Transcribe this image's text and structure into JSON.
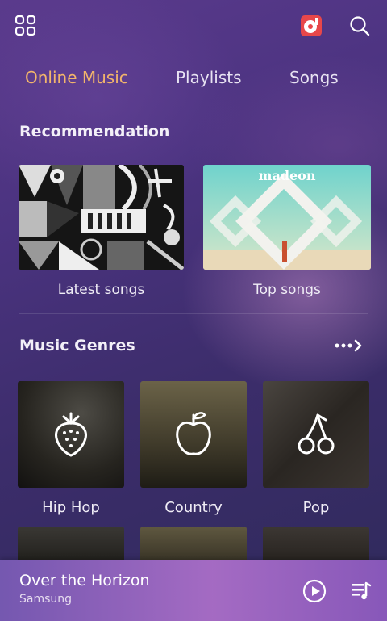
{
  "topbar": {
    "menu_icon": "grid-menu-icon",
    "music_app_icon": "music-disc-icon",
    "search_icon": "search-icon"
  },
  "tabs": [
    {
      "label": "Online Music",
      "active": true
    },
    {
      "label": "Playlists",
      "active": false
    },
    {
      "label": "Songs",
      "active": false
    }
  ],
  "recommendation": {
    "title": "Recommendation",
    "cards": [
      {
        "label": "Latest songs",
        "art": "abstract-mosaic-art"
      },
      {
        "label": "Top songs",
        "art": "madeon-album-art",
        "art_text": "madeon"
      }
    ]
  },
  "genres": {
    "title": "Music Genres",
    "more_icon": "more-arrow-icon",
    "items": [
      {
        "label": "Hip Hop",
        "icon": "strawberry-icon"
      },
      {
        "label": "Country",
        "icon": "apple-icon"
      },
      {
        "label": "Pop",
        "icon": "cherries-icon"
      }
    ]
  },
  "mini_player": {
    "title": "Over the Horizon",
    "artist": "Samsung",
    "play_icon": "play-circle-icon",
    "queue_icon": "playlist-queue-icon"
  },
  "colors": {
    "accent": "#f2b56b",
    "background": "#4b3380"
  }
}
